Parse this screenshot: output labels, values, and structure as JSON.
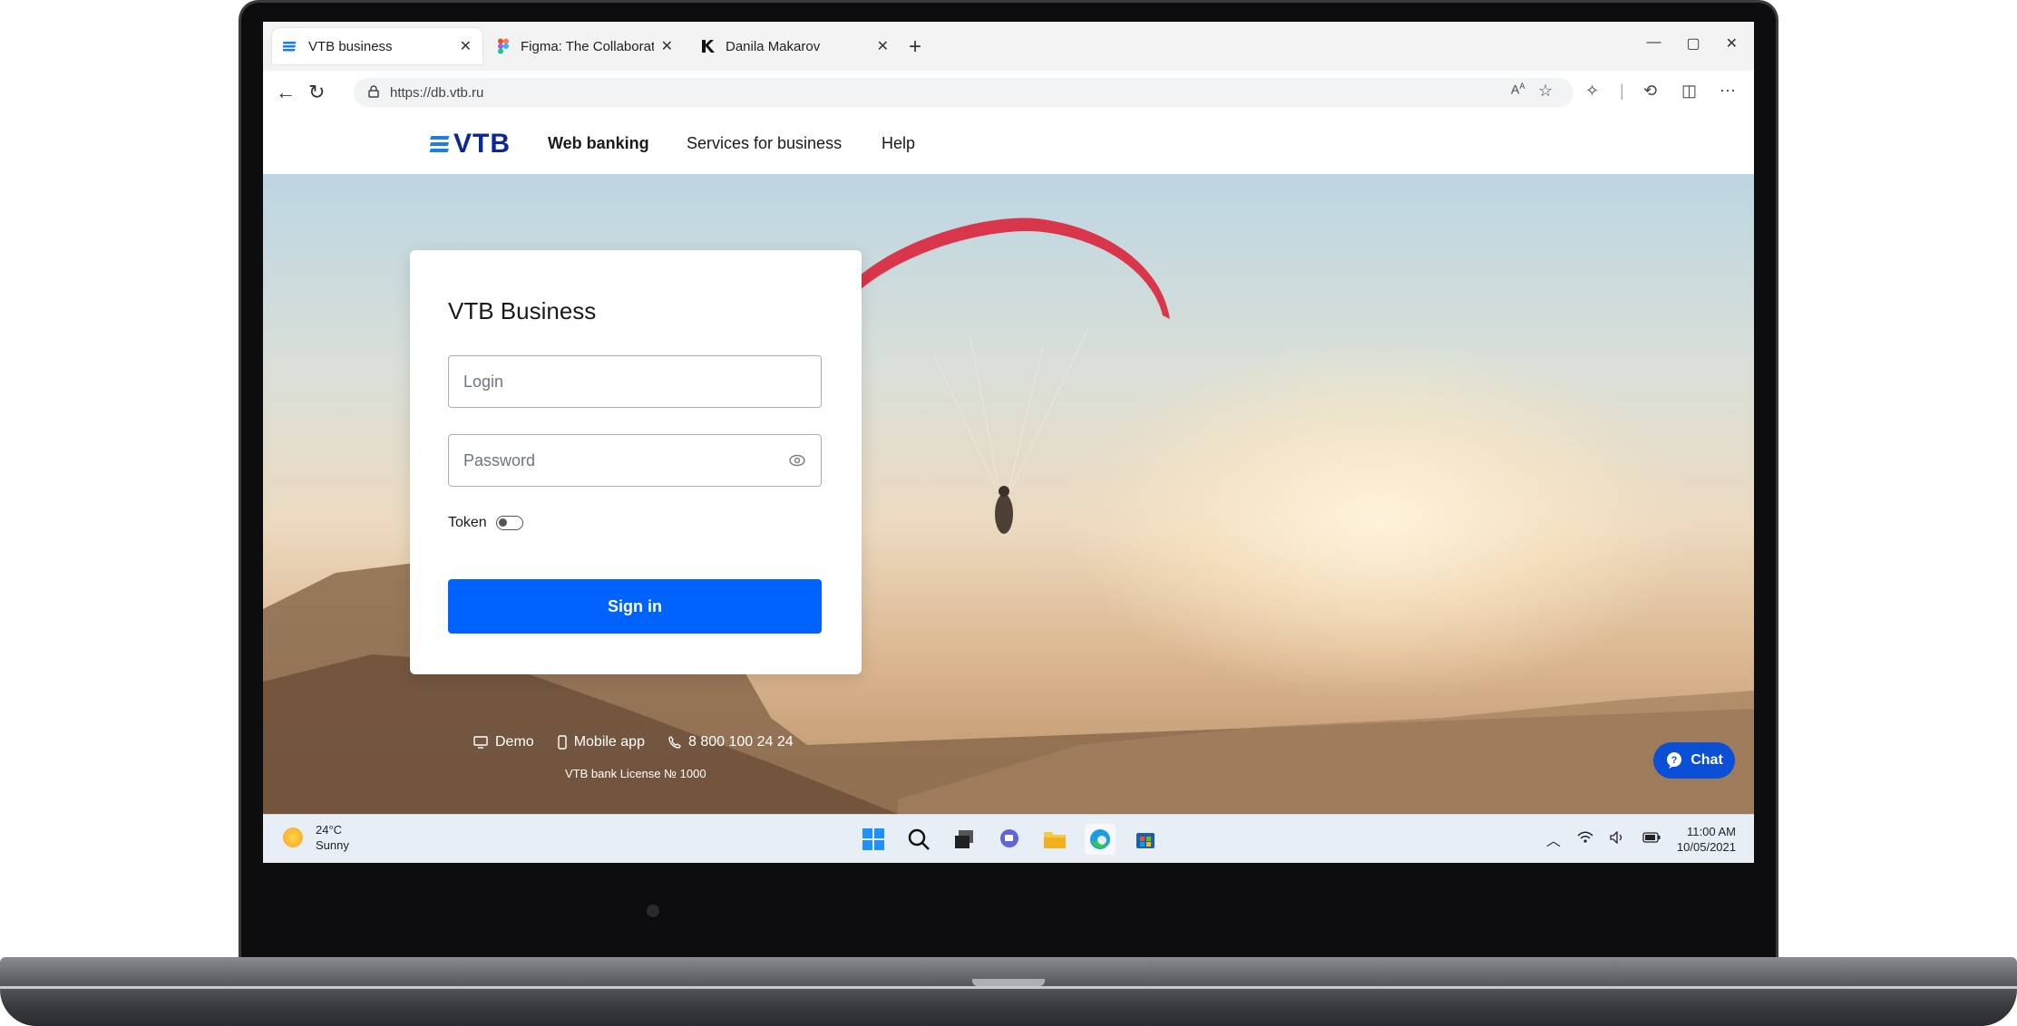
{
  "browser": {
    "tabs": [
      {
        "label": "VTB business",
        "icon": "vtb-logo-icon",
        "active": true
      },
      {
        "label": "Figma: The Collaborative",
        "icon": "figma-icon",
        "active": false
      },
      {
        "label": "Danila Makarov",
        "icon": "danila-logo-icon",
        "active": false
      }
    ],
    "new_tab": "+",
    "url": "https://db.vtb.ru"
  },
  "site": {
    "logo_text": "VTB",
    "nav": [
      "Web banking",
      "Services for business",
      "Help"
    ]
  },
  "login": {
    "title": "VTB Business",
    "login_placeholder": "Login",
    "password_placeholder": "Password",
    "token_label": "Token",
    "token_enabled": false,
    "signin_label": "Sign in"
  },
  "footer": {
    "demo": "Demo",
    "mobile_app": "Mobile app",
    "phone": "8 800 100 24 24",
    "license": "VTB bank License № 1000"
  },
  "chat_label": "Chat",
  "taskbar": {
    "temperature": "24°C",
    "weather": "Sunny",
    "time": "11:00 AM",
    "date": "10/05/2021"
  },
  "colors": {
    "primary": "#0062ff",
    "brand": "#0a2896",
    "chat": "#0a4fd6"
  }
}
